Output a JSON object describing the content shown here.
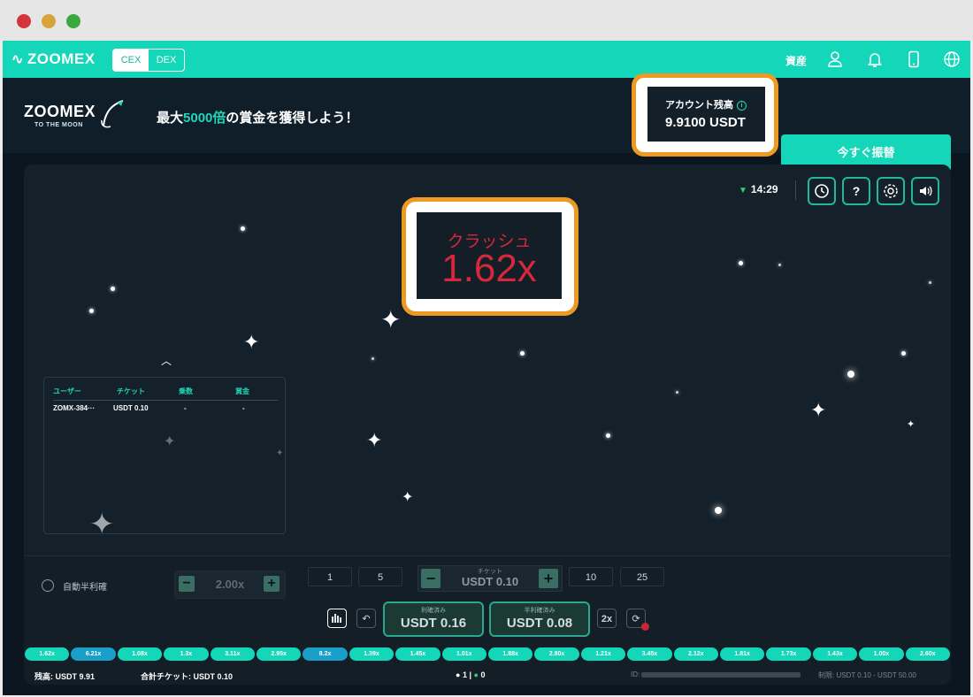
{
  "topnav": {
    "logo": "ZOOMEX",
    "tabs": [
      "CEX",
      "DEX"
    ],
    "assets_label": "資産",
    "icons": [
      "user-icon",
      "bell-icon",
      "phone-icon",
      "globe-icon"
    ]
  },
  "banner": {
    "logo": "ZOOMEX",
    "logo_sub": "TO THE MOON",
    "slogan_pre": "最大",
    "slogan_highlight": "5000倍",
    "slogan_post": "の賞金を獲得しよう！",
    "balance_label": "アカウント残高",
    "balance_value": "9.9100 USDT",
    "transfer_label": "今すぐ振替"
  },
  "game": {
    "time": "14:29",
    "crash_label": "クラッシュ",
    "crash_value": "1.62x",
    "table_headers": [
      "ユーザー",
      "チケット",
      "乗数",
      "賞金"
    ],
    "table_rows": [
      [
        "ZOMX-384···",
        "USDT 0.10",
        "-",
        "-"
      ]
    ]
  },
  "controls": {
    "auto_label": "自動半利確",
    "auto_value": "2.00x",
    "quick_left": [
      "1",
      "5"
    ],
    "quick_right": [
      "10",
      "25"
    ],
    "ticket_label": "チケット",
    "ticket_value": "USDT 0.10",
    "win_label": "利確済み",
    "win_value": "USDT 0.16",
    "half_label": "半利確済み",
    "half_value": "USDT 0.08",
    "double_label": "2x"
  },
  "history": [
    "1.62x",
    "6.21x",
    "1.08x",
    "1.3x",
    "3.11x",
    "2.95x",
    "8.2x",
    "1.39x",
    "1.45x",
    "1.01x",
    "1.88x",
    "2.80x",
    "1.21x",
    "3.45x",
    "2.12x",
    "1.81x",
    "1.73x",
    "1.43x",
    "1.00x",
    "2.60x"
  ],
  "footer": {
    "balance": "残高: USDT 9.91",
    "total_ticket": "合計チケット: USDT 0.10",
    "players_count": "1",
    "divider": "|",
    "winners_count": "0",
    "id_label": "ID:",
    "limit": "制限: USDT 0.10 - USDT 50.00"
  }
}
